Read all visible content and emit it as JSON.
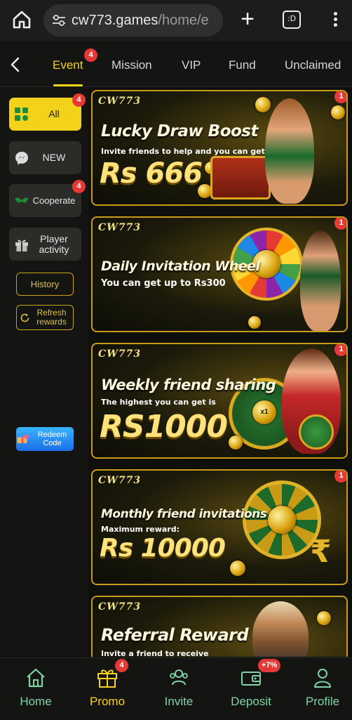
{
  "browser": {
    "url_host": "cw773.games",
    "url_path": "/home/e",
    "tabs_icon_text": ":D"
  },
  "topnav": {
    "tabs": [
      {
        "label": "Event",
        "badge": "4",
        "active": true
      },
      {
        "label": "Mission"
      },
      {
        "label": "VIP"
      },
      {
        "label": "Fund"
      },
      {
        "label": "Unclaimed"
      }
    ]
  },
  "sidebar": {
    "items": [
      {
        "label": "All",
        "badge": "4",
        "active": true
      },
      {
        "label": "NEW"
      },
      {
        "label": "Cooperate",
        "badge": "4"
      },
      {
        "label": "Player activity"
      }
    ],
    "history_label": "History",
    "refresh_label": "Refresh rewards",
    "redeem_label": "Redeem Code"
  },
  "banners": [
    {
      "logo": "CW773",
      "title": "Lucky Draw Boost",
      "subtitle": "Invite friends to help and you can get",
      "amount": "Rs 666",
      "badge": "1"
    },
    {
      "logo": "CW773",
      "title": "Daily Invitation Wheel",
      "subtitle": "You can get up to Rs300",
      "badge": "1"
    },
    {
      "logo": "CW773",
      "title": "Weekly friend sharing",
      "subtitle": "The highest you can get is",
      "amount": "RS1000",
      "badge": "1",
      "wheel_center": "x1"
    },
    {
      "logo": "CW773",
      "title": "Monthly friend invitations",
      "subtitle": "Maximum reward:",
      "amount": "Rs 10000",
      "badge": "1"
    },
    {
      "logo": "CW773",
      "title": "Referral Reward",
      "subtitle": "Invite a friend to receive"
    }
  ],
  "bottom_nav": {
    "items": [
      {
        "label": "Home",
        "icon": "home-icon"
      },
      {
        "label": "Promo",
        "icon": "gift-icon",
        "badge": "4",
        "active": true
      },
      {
        "label": "Invite",
        "icon": "invite-icon"
      },
      {
        "label": "Deposit",
        "icon": "wallet-icon",
        "badge": "+7%"
      },
      {
        "label": "Profile",
        "icon": "profile-icon"
      }
    ]
  },
  "colors": {
    "accent": "#f4d21c",
    "nav_text": "#7fd4a6",
    "badge": "#e53935",
    "banner_border": "#c89b18"
  }
}
